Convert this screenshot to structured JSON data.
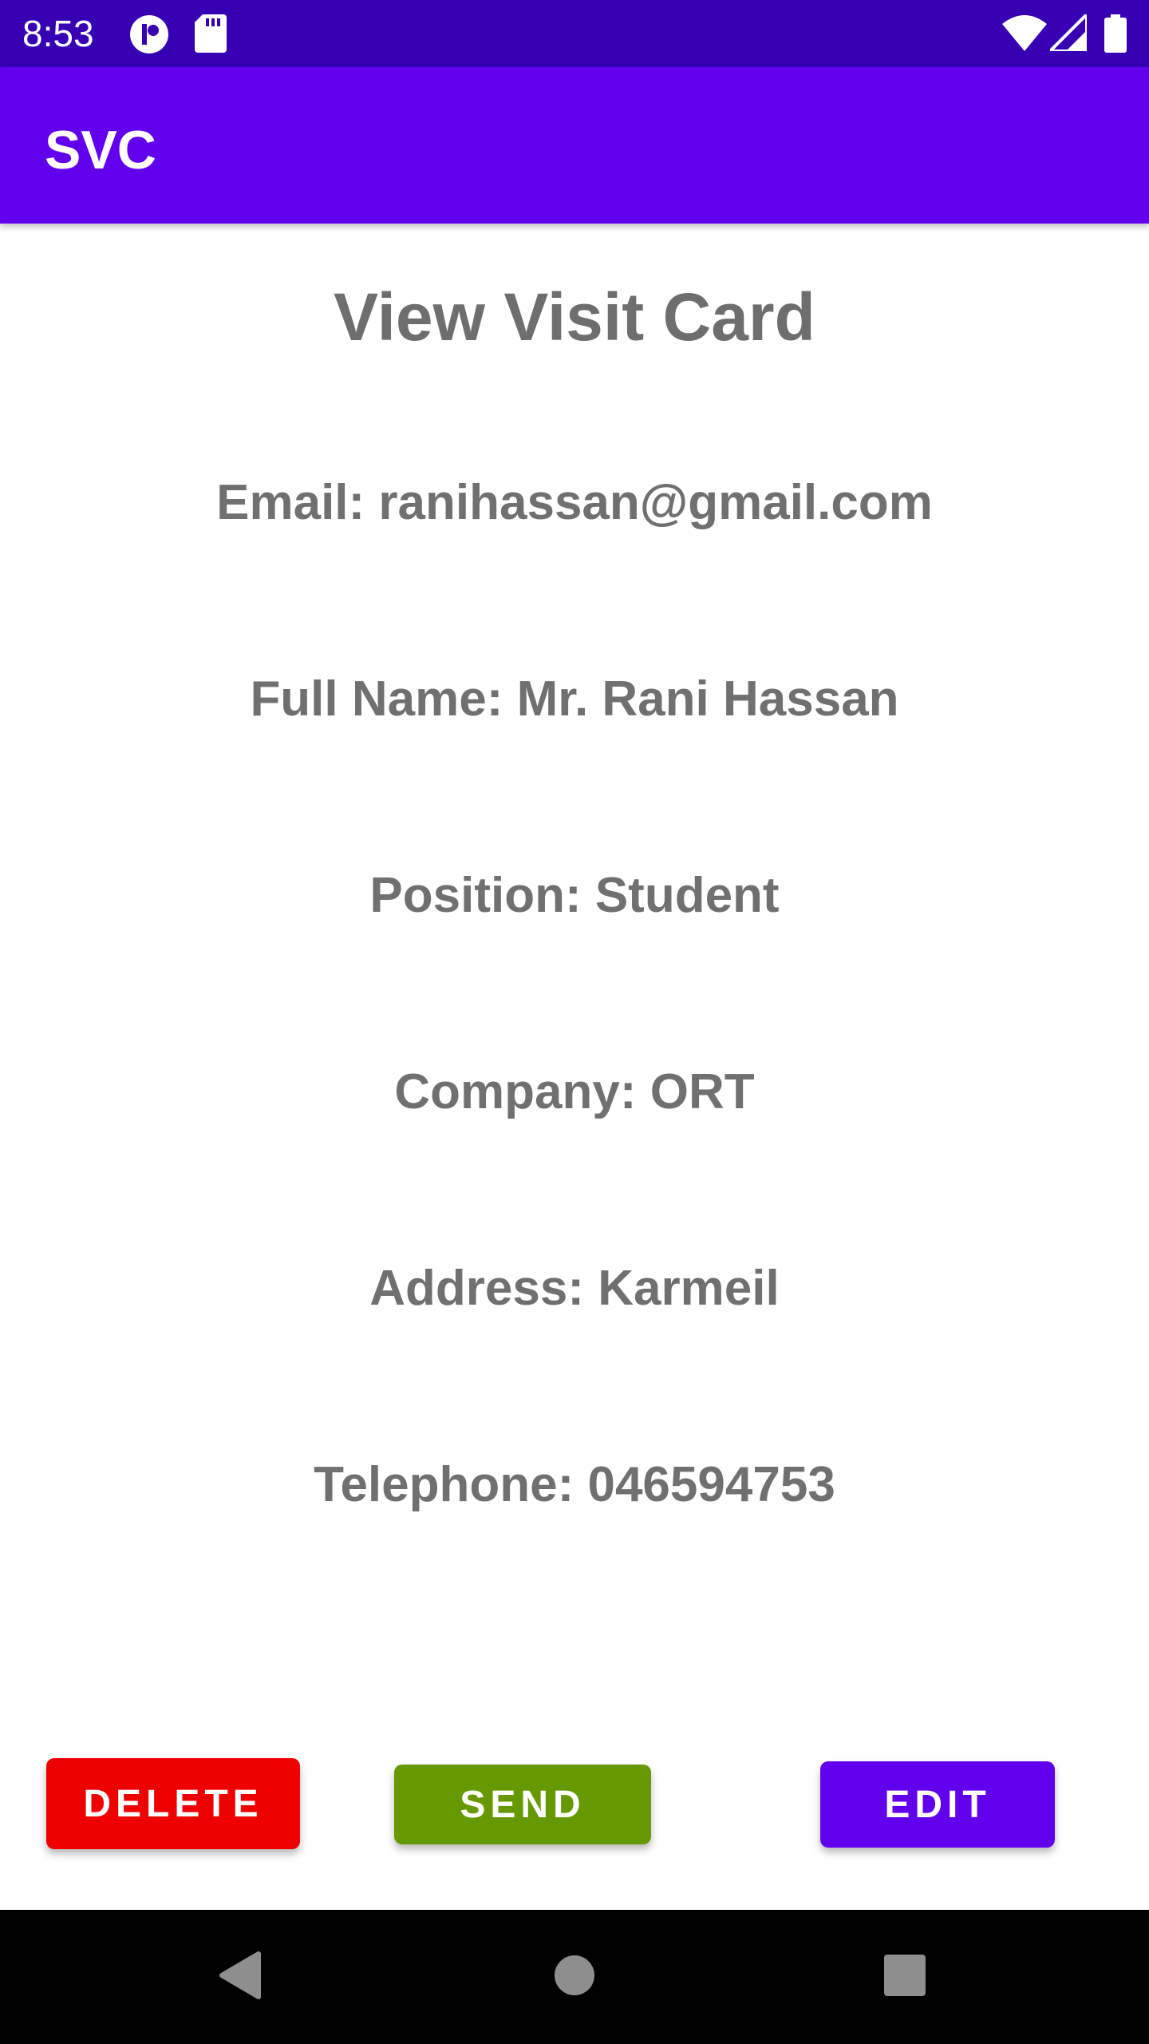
{
  "status_bar": {
    "time": "8:53",
    "icons": [
      "profile-notification-icon",
      "sd-card-icon",
      "wifi-icon",
      "cellular-signal-icon",
      "battery-icon"
    ]
  },
  "app_bar": {
    "title": "SVC"
  },
  "main": {
    "heading": "View Visit Card",
    "fields": {
      "email": "Email: ranihassan@gmail.com",
      "full_name": "Full Name: Mr. Rani Hassan",
      "position": "Position: Student",
      "company": "Company: ORT",
      "address": "Address: Karmeil",
      "telephone": "Telephone: 046594753"
    }
  },
  "actions": {
    "delete_label": "DELETE",
    "send_label": "SEND",
    "edit_label": "EDIT"
  },
  "nav_bar": {
    "icons": [
      "back-icon",
      "home-icon",
      "recents-icon"
    ]
  },
  "colors": {
    "status_bar": "#3700b3",
    "app_bar": "#6200ee",
    "text": "#707070",
    "delete": "#ee0000",
    "send": "#669900",
    "edit": "#6200ee"
  }
}
